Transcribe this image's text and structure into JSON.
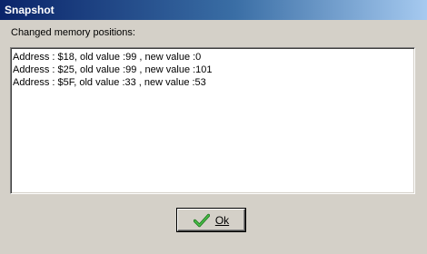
{
  "window": {
    "title": "Snapshot"
  },
  "caption": "Changed memory positions:",
  "changes": [
    "Address : $18, old value :99 , new value :0",
    "Address : $25, old value :99 , new value :101",
    "Address : $5F, old value :33 , new value :53"
  ],
  "ok_button": {
    "label": "Ok",
    "icon": "checkmark-icon",
    "icon_color": "#2e9a2e"
  },
  "colors": {
    "titlebar_start": "#0a246a",
    "titlebar_end": "#a6caf0",
    "dialog_bg": "#d4d0c8"
  }
}
